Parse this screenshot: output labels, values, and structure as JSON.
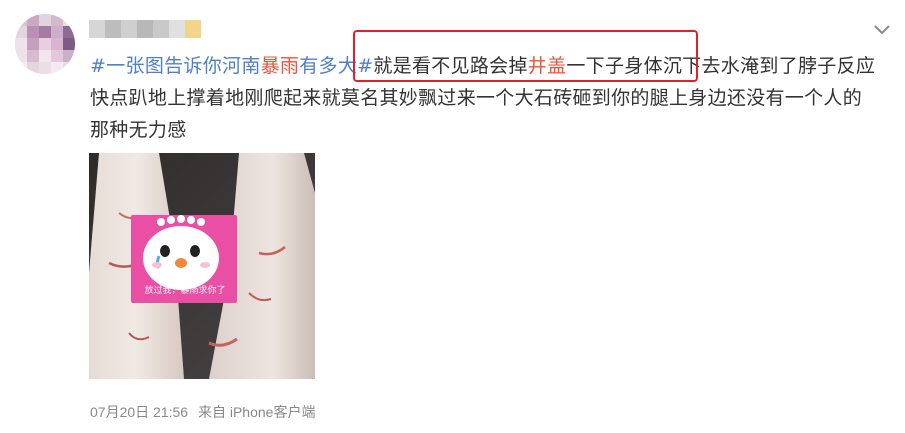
{
  "post": {
    "hashtag_prefix": "#一张图告诉你河南",
    "hashtag_red": "暴雨",
    "hashtag_suffix": "有多大#",
    "text_part1": "就是看不见路会掉",
    "text_highlight": "井盖",
    "text_part2": "一下子身体沉下去水淹到了脖子反应快点趴地上撑着地刚爬起来就莫名其妙飘过来一个大石砖砸到你的腿上身边还没有一个人的那种无力感"
  },
  "meta": {
    "timestamp": "07月20日 21:56",
    "source": "来自 iPhone客户端"
  },
  "sticker": {
    "caption": "放过我，暴雨求你了"
  },
  "colors": {
    "link_blue": "#4f7fc9",
    "link_red": "#e8543d",
    "highlight_border": "#e0202a",
    "meta_gray": "#888888"
  },
  "icons": {
    "more": "chevron-down-icon"
  }
}
